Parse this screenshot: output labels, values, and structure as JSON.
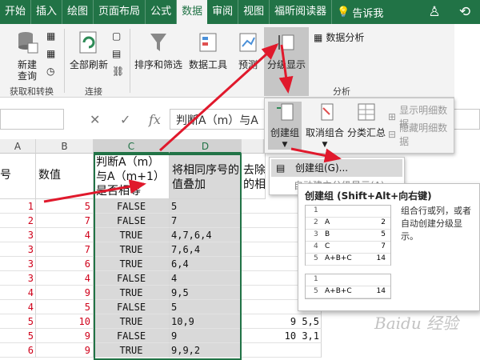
{
  "tabs": [
    "开始",
    "插入",
    "绘图",
    "页面布局",
    "公式",
    "数据",
    "审阅",
    "视图",
    "福昕阅读器"
  ],
  "active_tab": "数据",
  "tell_me": "告诉我",
  "ribbon": {
    "new_query": "新建\n查询",
    "refresh_all": "全部刷新",
    "sort_filter": "排序和筛选",
    "data_tools": "数据工具",
    "forecast": "预测",
    "outline": "分级显示",
    "data_analysis": "数据分析",
    "group_get_transform": "获取和转换",
    "group_connections": "连接",
    "group_analysis": "分析"
  },
  "formula_bar": {
    "cancel": "✕",
    "confirm": "✓",
    "fx": "fx",
    "content": "判断A（m）与A"
  },
  "columns": [
    "A",
    "B",
    "C",
    "D"
  ],
  "headers": {
    "a": "号",
    "b": "数值",
    "c": "判断A（m）与A（m+1）是否相等",
    "d": "将相同序号的值叠加",
    "e": "去除\n的相"
  },
  "rows": [
    {
      "a": "1",
      "b": "5",
      "c": "FALSE",
      "d": "5",
      "e": ""
    },
    {
      "a": "2",
      "b": "7",
      "c": "FALSE",
      "d": "7",
      "e": ""
    },
    {
      "a": "3",
      "b": "4",
      "c": "TRUE",
      "d": "4,7,6,4",
      "e": ""
    },
    {
      "a": "3",
      "b": "7",
      "c": "TRUE",
      "d": "7,6,4",
      "e": ""
    },
    {
      "a": "3",
      "b": "6",
      "c": "TRUE",
      "d": "6,4",
      "e": ""
    },
    {
      "a": "3",
      "b": "4",
      "c": "FALSE",
      "d": "4",
      "e": ""
    },
    {
      "a": "4",
      "b": "9",
      "c": "TRUE",
      "d": "9,5",
      "e": ""
    },
    {
      "a": "4",
      "b": "5",
      "c": "FALSE",
      "d": "5",
      "e": ""
    },
    {
      "a": "5",
      "b": "10",
      "c": "TRUE",
      "d": "10,9",
      "e": "9 5,5"
    },
    {
      "a": "5",
      "b": "9",
      "c": "FALSE",
      "d": "9",
      "e": "10 3,1"
    },
    {
      "a": "6",
      "b": "9",
      "c": "TRUE",
      "d": "9,9,2",
      "e": ""
    }
  ],
  "outline_menu": {
    "group": "创建组",
    "ungroup": "取消组合",
    "subtotal": "分类汇总",
    "show_detail": "显示明细数据",
    "hide_detail": "隐藏明细数据",
    "submenu_item": "创建组(G)...",
    "submenu_item2": "自动建立分级显示(A)"
  },
  "tooltip": {
    "title": "创建组 (Shift+Alt+向右键)",
    "desc": "组合行或列，或者自动创建分级显示。",
    "mini_top": [
      {
        "n": "1",
        "k": "",
        "v": ""
      },
      {
        "n": "2",
        "k": "A",
        "v": "2"
      },
      {
        "n": "3",
        "k": "B",
        "v": "5"
      },
      {
        "n": "4",
        "k": "C",
        "v": "7"
      },
      {
        "n": "5",
        "k": "A+B+C",
        "v": "14"
      }
    ],
    "mini_bottom": [
      {
        "n": "1",
        "k": "",
        "v": ""
      },
      {
        "n": "5",
        "k": "A+B+C",
        "v": "14"
      }
    ]
  },
  "watermark": "Baidu 经验",
  "colors": {
    "accent": "#217346",
    "red": "#d0021b",
    "selection": "#d9d9d9"
  }
}
